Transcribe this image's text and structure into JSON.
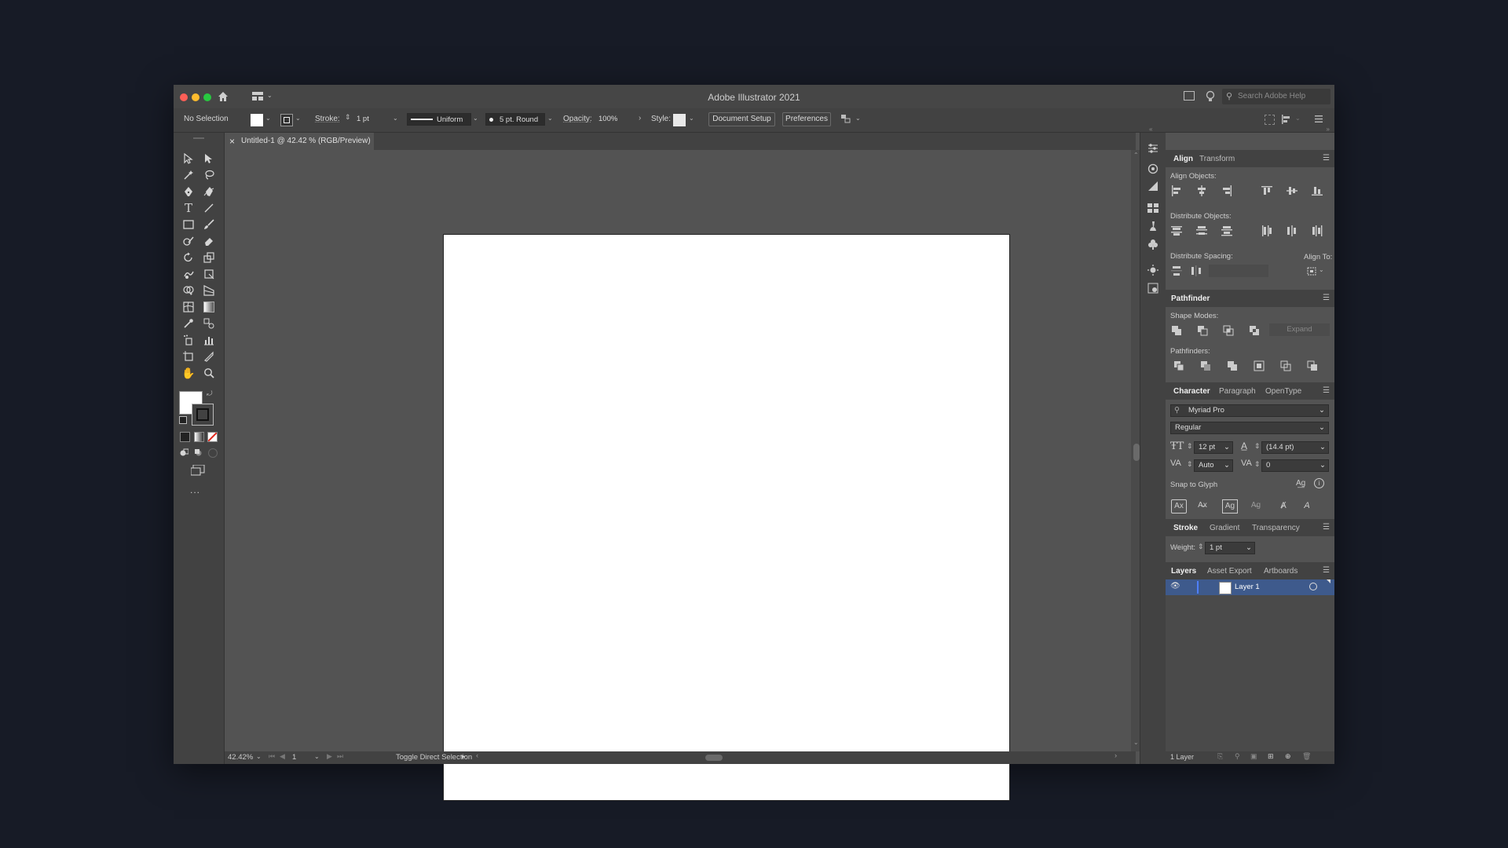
{
  "window": {
    "title": "Adobe Illustrator 2021",
    "search_placeholder": "Search Adobe Help"
  },
  "control_bar": {
    "selection_label": "No Selection",
    "stroke_label": "Stroke:",
    "stroke_value": "1 pt",
    "profile_value": "Uniform",
    "brush_value": "5 pt. Round",
    "opacity_label": "Opacity:",
    "opacity_value": "100%",
    "style_label": "Style:",
    "document_setup": "Document Setup",
    "preferences": "Preferences"
  },
  "document_tab": {
    "close": "×",
    "title": "Untitled-1 @ 42.42 % (RGB/Preview)"
  },
  "toolbar": {
    "more": "..."
  },
  "status_bar": {
    "zoom": "42.42%",
    "artboard_number": "1",
    "status_text": "Toggle Direct Selection"
  },
  "align_panel": {
    "tabs": [
      "Align",
      "Transform"
    ],
    "align_objects_label": "Align Objects:",
    "distribute_objects_label": "Distribute Objects:",
    "distribute_spacing_label": "Distribute Spacing:",
    "align_to_label": "Align To:"
  },
  "pathfinder_panel": {
    "title": "Pathfinder",
    "shape_modes_label": "Shape Modes:",
    "expand_label": "Expand",
    "pathfinders_label": "Pathfinders:"
  },
  "character_panel": {
    "tabs": [
      "Character",
      "Paragraph",
      "OpenType"
    ],
    "font_family": "Myriad Pro",
    "font_style": "Regular",
    "font_size": "12 pt",
    "leading": "(14.4 pt)",
    "kerning": "Auto",
    "tracking": "0",
    "snap_to_glyph_label": "Snap to Glyph"
  },
  "stroke_panel": {
    "tabs": [
      "Stroke",
      "Gradient",
      "Transparency"
    ],
    "weight_label": "Weight:",
    "weight_value": "1 pt"
  },
  "layers_panel": {
    "tabs": [
      "Layers",
      "Asset Export",
      "Artboards"
    ],
    "layer_name": "Layer 1",
    "footer_count": "1 Layer"
  },
  "colors": {
    "background": "#171b26",
    "ui_panel": "#424242",
    "canvas": "#535353",
    "selection_highlight": "#3e5a8c"
  }
}
